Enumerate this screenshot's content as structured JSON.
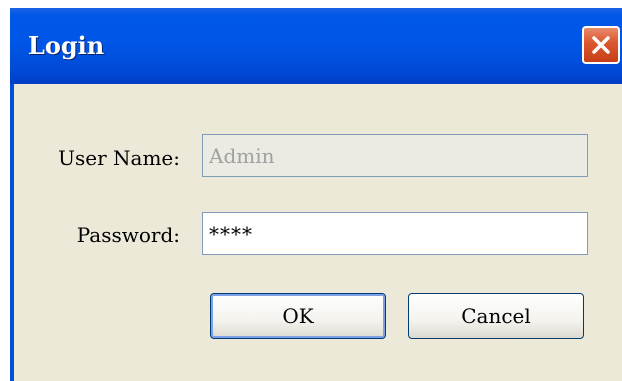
{
  "window": {
    "title": "Login"
  },
  "icons": {
    "close": "close-icon"
  },
  "form": {
    "username_label": "User Name:",
    "username_value": "Admin",
    "password_label": "Password:",
    "password_value": "****"
  },
  "buttons": {
    "ok_label": "OK",
    "cancel_label": "Cancel"
  },
  "colors": {
    "titlebar": "#0055e5",
    "close_button": "#db5a32",
    "dialog_background": "#ece9d8",
    "button_border": "#003c74"
  }
}
